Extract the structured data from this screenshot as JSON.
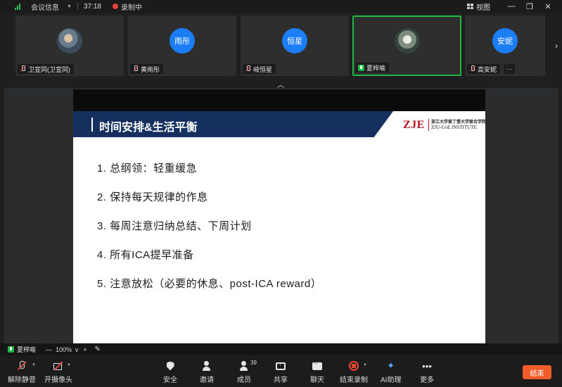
{
  "topbar": {
    "meeting_info": "会议信息",
    "timer": "37:18",
    "recording": "录制中",
    "view": "视图",
    "minimize": "—",
    "restore": "❐",
    "close": "✕"
  },
  "participants": [
    {
      "name": "卫宣同(卫宣同)",
      "avatar_text": "",
      "muted": true
    },
    {
      "name": "黄雨彤",
      "avatar_text": "雨彤",
      "muted": true
    },
    {
      "name": "岐恒星",
      "avatar_text": "恒星",
      "muted": true
    },
    {
      "name": "夏梓喻",
      "avatar_text": "",
      "muted": false,
      "active": true
    },
    {
      "name": "高安妮",
      "avatar_text": "安妮",
      "muted": true
    }
  ],
  "slide": {
    "title": "时间安排&生活平衡",
    "logo_mark": "ZJE",
    "logo_cn": "浙江大学爱丁堡大学联合学院",
    "logo_en": "ZJU-UoE INSTITUTE",
    "items": [
      "1. 总纲领：轻重缓急",
      "2. 保持每天规律的作息",
      "3. 每周注意归纳总结、下周计划",
      "4. 所有ICA提早准备",
      "5. 注意放松（必要的休息、post-ICA reward）"
    ]
  },
  "share_controls": {
    "sharer": "夏梓喻",
    "zoom_minus": "—",
    "zoom": "100%",
    "zoom_caret": "v",
    "zoom_plus": "+"
  },
  "toolbar": {
    "mute": "解除静音",
    "camera": "开摄像头",
    "security": "安全",
    "invite": "邀请",
    "members": "成员",
    "member_count": "39",
    "share": "共享",
    "chat": "聊天",
    "end_record": "结束录制",
    "ai": "AI助理",
    "more": "更多",
    "end": "结束"
  },
  "colors": {
    "accent_green": "#1fb844",
    "avatar_blue": "#1b7ef7",
    "slide_header": "#15305f",
    "logo_red": "#b5121b",
    "end_button": "#f25b2a"
  }
}
